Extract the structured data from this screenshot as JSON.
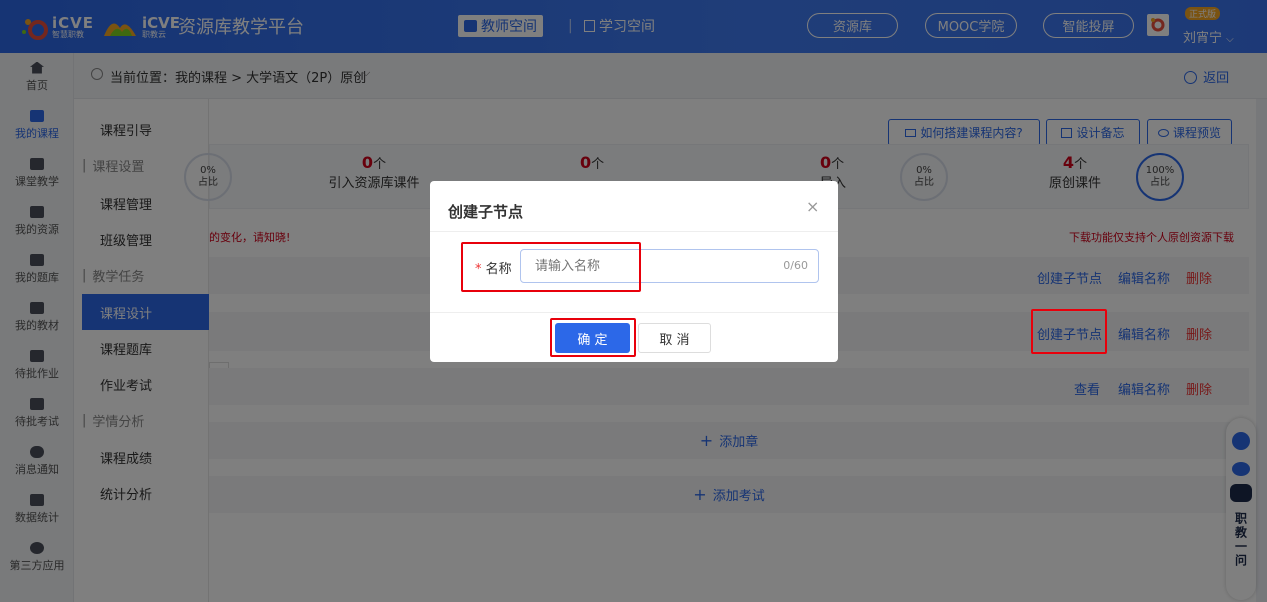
{
  "header": {
    "logo1_text": "iCVE",
    "logo1_sub": "智慧职教",
    "logo2_text": "iCVE",
    "logo2_sub": "职教云",
    "platform_title": "资源库教学平台",
    "nav_teacher": "教师空间",
    "nav_student": "学习空间",
    "pill_resource": "资源库",
    "pill_mooc": "MOOC学院",
    "pill_smart": "智能投屏",
    "badge": "正式版",
    "user_name": "刘宵宁"
  },
  "left_rail": [
    {
      "label": "首页"
    },
    {
      "label": "我的课程"
    },
    {
      "label": "课堂教学"
    },
    {
      "label": "我的资源"
    },
    {
      "label": "我的题库"
    },
    {
      "label": "我的教材"
    },
    {
      "label": "待批作业"
    },
    {
      "label": "待批考试"
    },
    {
      "label": "消息通知"
    },
    {
      "label": "数据统计"
    },
    {
      "label": "第三方应用"
    }
  ],
  "breadcrumb": {
    "prefix": "当前位置：我的课程 > 大学语文（2P）原创",
    "back": "返回"
  },
  "menu": [
    {
      "label": "课程引导",
      "type": "item"
    },
    {
      "label": "课程设置",
      "type": "group"
    },
    {
      "label": "课程管理",
      "type": "item"
    },
    {
      "label": "班级管理",
      "type": "item"
    },
    {
      "label": "教学任务",
      "type": "group"
    },
    {
      "label": "课程设计",
      "type": "item",
      "active": true
    },
    {
      "label": "课程题库",
      "type": "item"
    },
    {
      "label": "作业考试",
      "type": "item"
    },
    {
      "label": "学情分析",
      "type": "group"
    },
    {
      "label": "课程成绩",
      "type": "item"
    },
    {
      "label": "统计分析",
      "type": "item"
    }
  ],
  "toolbar": {
    "how_to": "如何搭建课程内容?",
    "memo": "设计备忘",
    "preview": "课程预览"
  },
  "stats": {
    "c1_pct": "0%",
    "c1_label": "占比",
    "s1_count": "0",
    "s1_unit": "个",
    "s1_label": "引入资源库课件",
    "s2_count": "0",
    "s2_unit": "个",
    "s3_count": "0",
    "s3_unit": "个",
    "s3_label": "导入",
    "c3_pct": "0%",
    "c3_label": "占比",
    "s4_count": "4",
    "s4_unit": "个",
    "s4_label": "原创课件",
    "c4_pct": "100%",
    "c4_label": "占比"
  },
  "notices": {
    "left": "的变化，请知晓!",
    "right": "下载功能仅支持个人原创资源下载"
  },
  "rows": {
    "create_child": "创建子节点",
    "edit_name": "编辑名称",
    "delete": "删除",
    "view": "查看",
    "add_chapter": "添加章",
    "add_exam": "添加考试"
  },
  "dialog": {
    "title": "创建子节点",
    "required_mark": "*",
    "field_label": "名称",
    "placeholder": "请输入名称",
    "counter": "0/60",
    "confirm": "确 定",
    "cancel": "取 消"
  },
  "float_bar": {
    "text": "职教一问"
  },
  "colors": {
    "primary": "#2c68e8",
    "danger": "#e33",
    "highlight": "#e8000b"
  }
}
